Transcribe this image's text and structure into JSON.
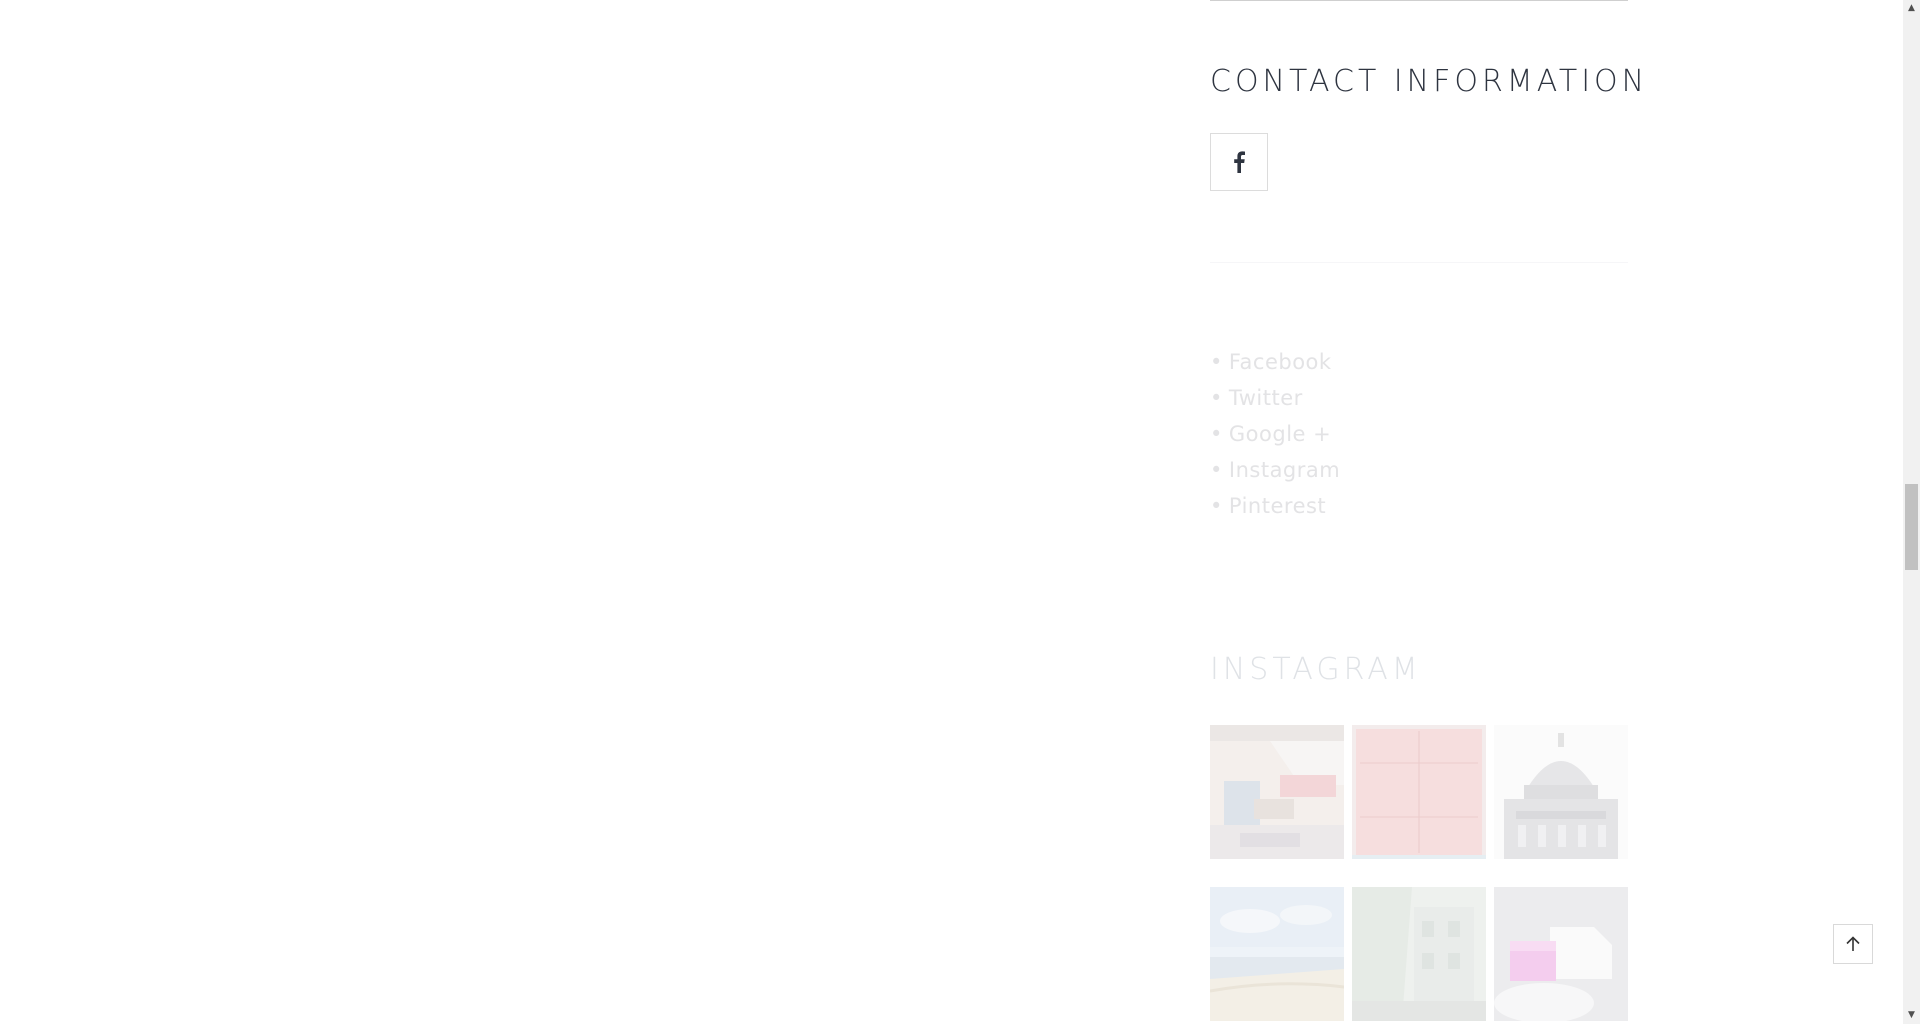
{
  "contact": {
    "title": "CONTACT INFORMATION",
    "facebook_icon": "facebook-icon"
  },
  "social_links": {
    "items": [
      {
        "bullet": "•",
        "label": "Facebook"
      },
      {
        "bullet": "•",
        "label": "Twitter"
      },
      {
        "bullet": "•",
        "label": "Google +"
      },
      {
        "bullet": "•",
        "label": "Instagram"
      },
      {
        "bullet": "•",
        "label": "Pinterest"
      }
    ]
  },
  "instagram": {
    "title": "INSTAGRAM",
    "photos": [
      {
        "subject": "living-room-photo"
      },
      {
        "subject": "red-door-photo"
      },
      {
        "subject": "domed-building-photo"
      },
      {
        "subject": "beach-sky-photo"
      },
      {
        "subject": "street-facade-photo"
      },
      {
        "subject": "pink-abstract-photo"
      }
    ]
  },
  "controls": {
    "back_to_top_icon": "arrow-up-icon",
    "scroll_up_glyph": "▲",
    "scroll_down_glyph": "▼"
  },
  "colors": {
    "heading": "#2e3440",
    "faded_text": "#e3e3e5",
    "border": "#dcdcdc"
  }
}
